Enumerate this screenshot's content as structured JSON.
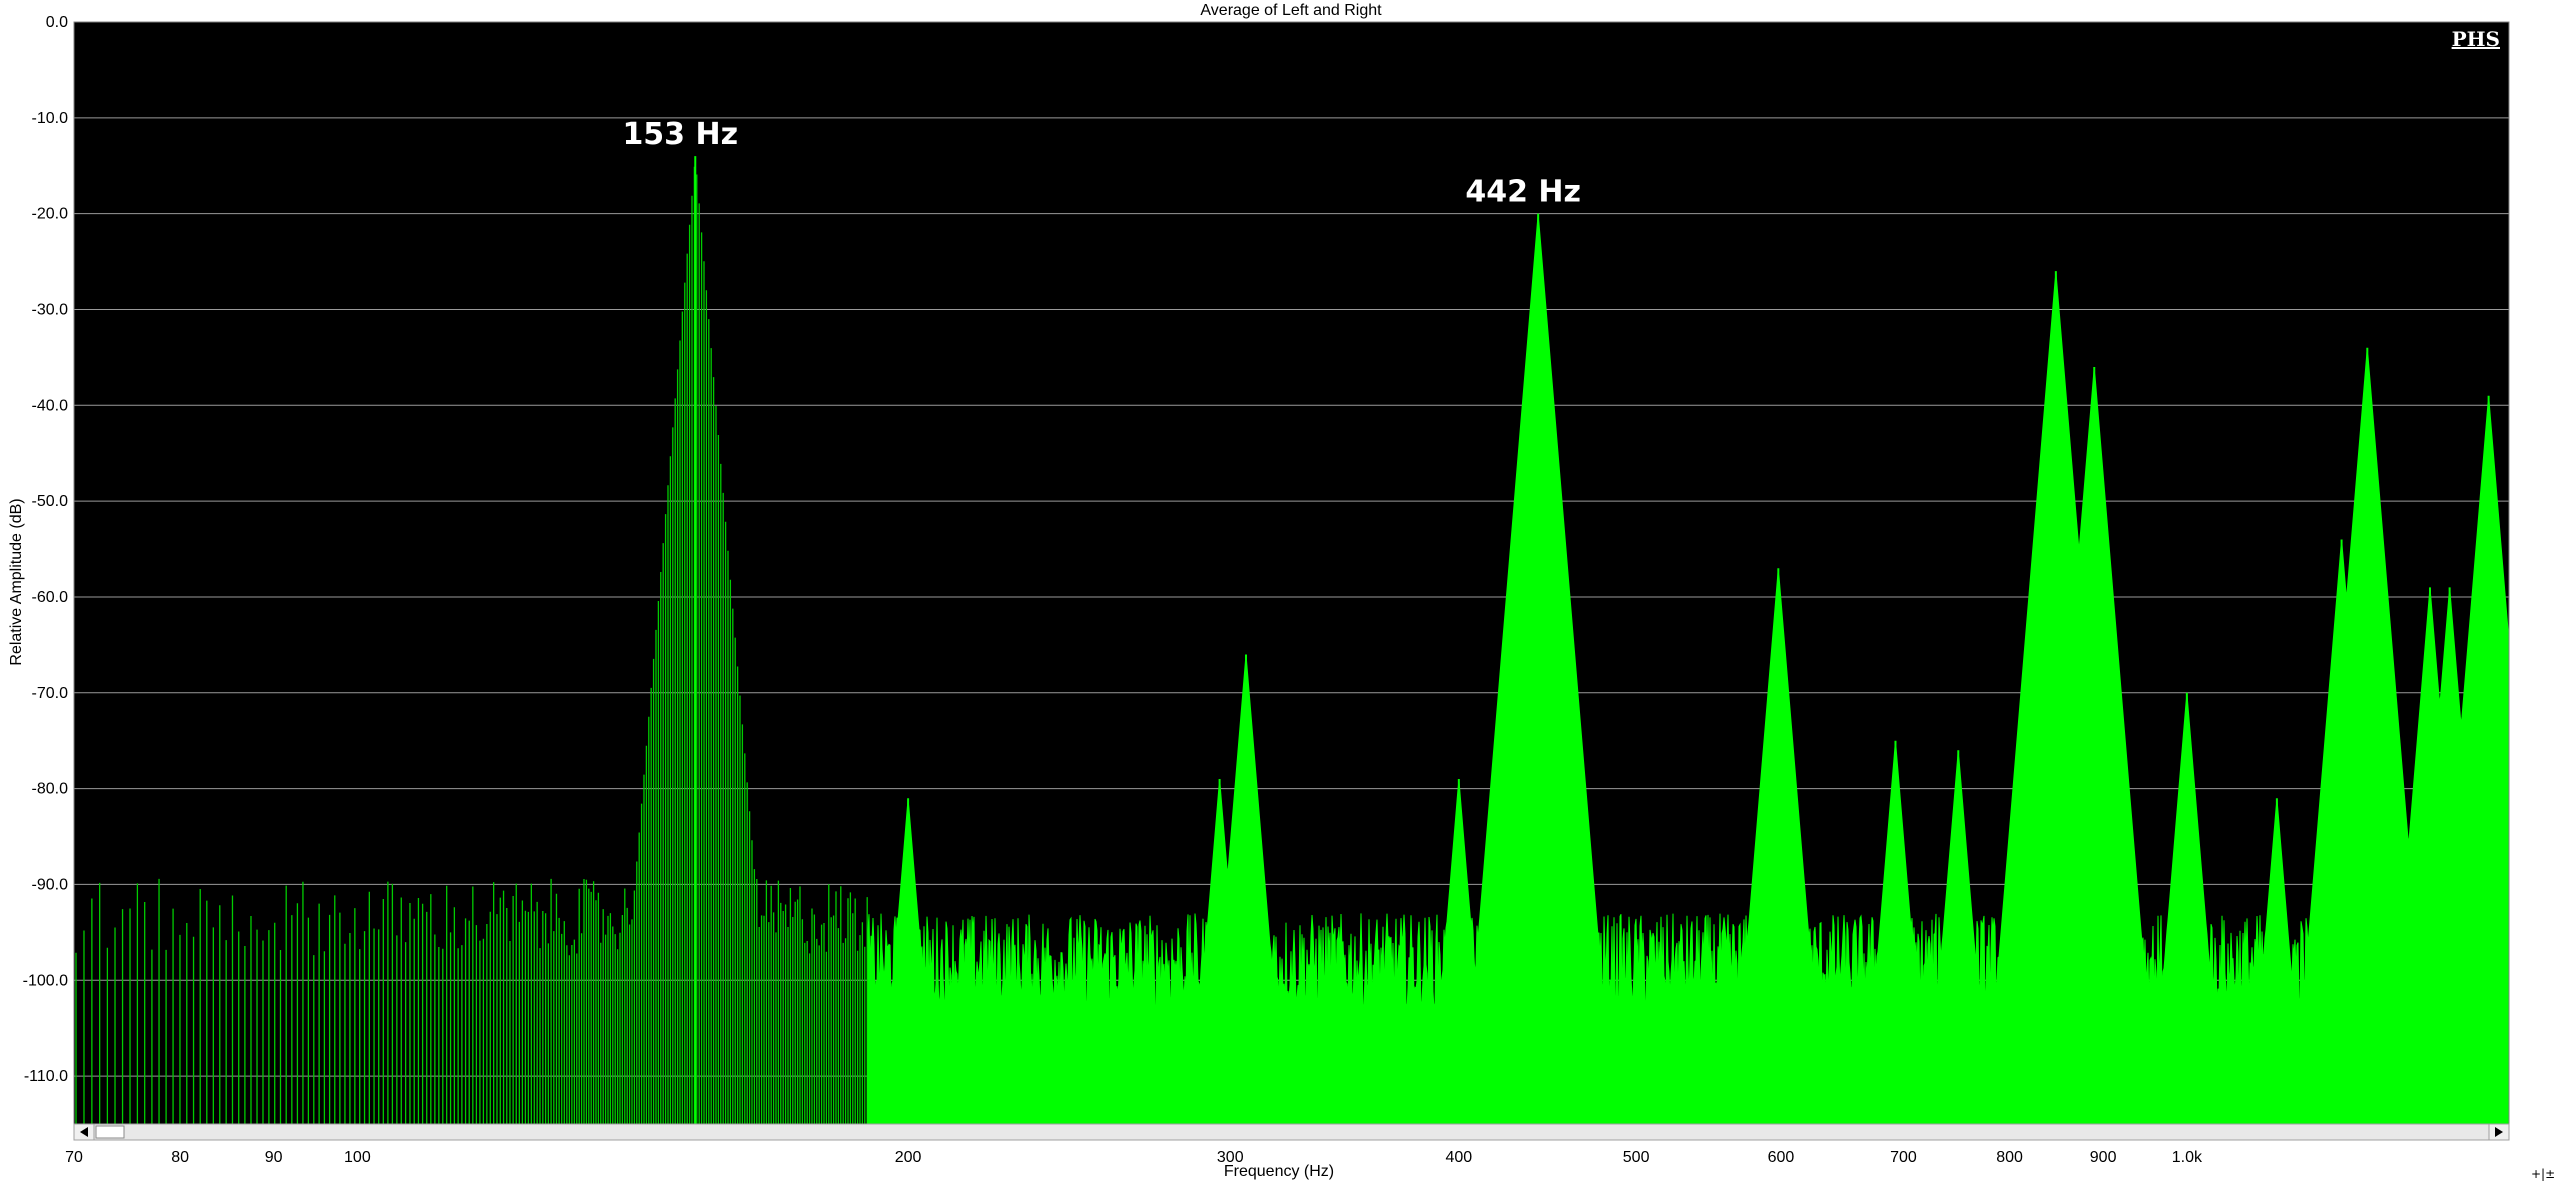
{
  "chart_data": {
    "type": "area",
    "title": "Average of Left and Right",
    "xlabel": "Frequency (Hz)",
    "ylabel": "Relative Amplitude (dB)",
    "x_scale": "log",
    "xlim": [
      70,
      1500
    ],
    "ylim": [
      -115,
      0
    ],
    "x_ticks": [
      {
        "value": 70,
        "label": "70"
      },
      {
        "value": 80,
        "label": "80"
      },
      {
        "value": 90,
        "label": "90"
      },
      {
        "value": 100,
        "label": "100"
      },
      {
        "value": 200,
        "label": "200"
      },
      {
        "value": 300,
        "label": "300"
      },
      {
        "value": 400,
        "label": "400"
      },
      {
        "value": 500,
        "label": "500"
      },
      {
        "value": 600,
        "label": "600"
      },
      {
        "value": 700,
        "label": "700"
      },
      {
        "value": 800,
        "label": "800"
      },
      {
        "value": 900,
        "label": "900"
      },
      {
        "value": 1000,
        "label": "1.0k"
      }
    ],
    "y_ticks": [
      {
        "value": 0,
        "label": "0.0"
      },
      {
        "value": -10,
        "label": "-10.0"
      },
      {
        "value": -20,
        "label": "-20.0"
      },
      {
        "value": -30,
        "label": "-30.0"
      },
      {
        "value": -40,
        "label": "-40.0"
      },
      {
        "value": -50,
        "label": "-50.0"
      },
      {
        "value": -60,
        "label": "-60.0"
      },
      {
        "value": -70,
        "label": "-70.0"
      },
      {
        "value": -80,
        "label": "-80.0"
      },
      {
        "value": -90,
        "label": "-90.0"
      },
      {
        "value": -100,
        "label": "-100.0"
      },
      {
        "value": -110,
        "label": "-110.0"
      }
    ],
    "grid": true,
    "background": "#000000",
    "series_color": "#00ff00",
    "noise_floor_db": -98,
    "peaks": [
      {
        "freq": 153,
        "db": -14
      },
      {
        "freq": 442,
        "db": -20
      },
      {
        "freq": 848,
        "db": -26
      },
      {
        "freq": 890,
        "db": -36
      },
      {
        "freq": 1255,
        "db": -34
      },
      {
        "freq": 1462,
        "db": -39
      },
      {
        "freq": 1215,
        "db": -54
      },
      {
        "freq": 1392,
        "db": -59
      },
      {
        "freq": 1358,
        "db": -59
      },
      {
        "freq": 598,
        "db": -57
      },
      {
        "freq": 306,
        "db": -66
      },
      {
        "freq": 1000,
        "db": -70
      },
      {
        "freq": 693,
        "db": -75
      },
      {
        "freq": 1285,
        "db": -75
      },
      {
        "freq": 750,
        "db": -76
      },
      {
        "freq": 296,
        "db": -79
      },
      {
        "freq": 200,
        "db": -81
      },
      {
        "freq": 1120,
        "db": -81
      },
      {
        "freq": 460,
        "db": -81
      },
      {
        "freq": 400,
        "db": -79
      }
    ],
    "annotations": [
      {
        "freq": 153,
        "db": -14,
        "label": "153 Hz"
      },
      {
        "freq": 442,
        "db": -20,
        "label": "442 Hz"
      }
    ],
    "badge": "PHS"
  }
}
